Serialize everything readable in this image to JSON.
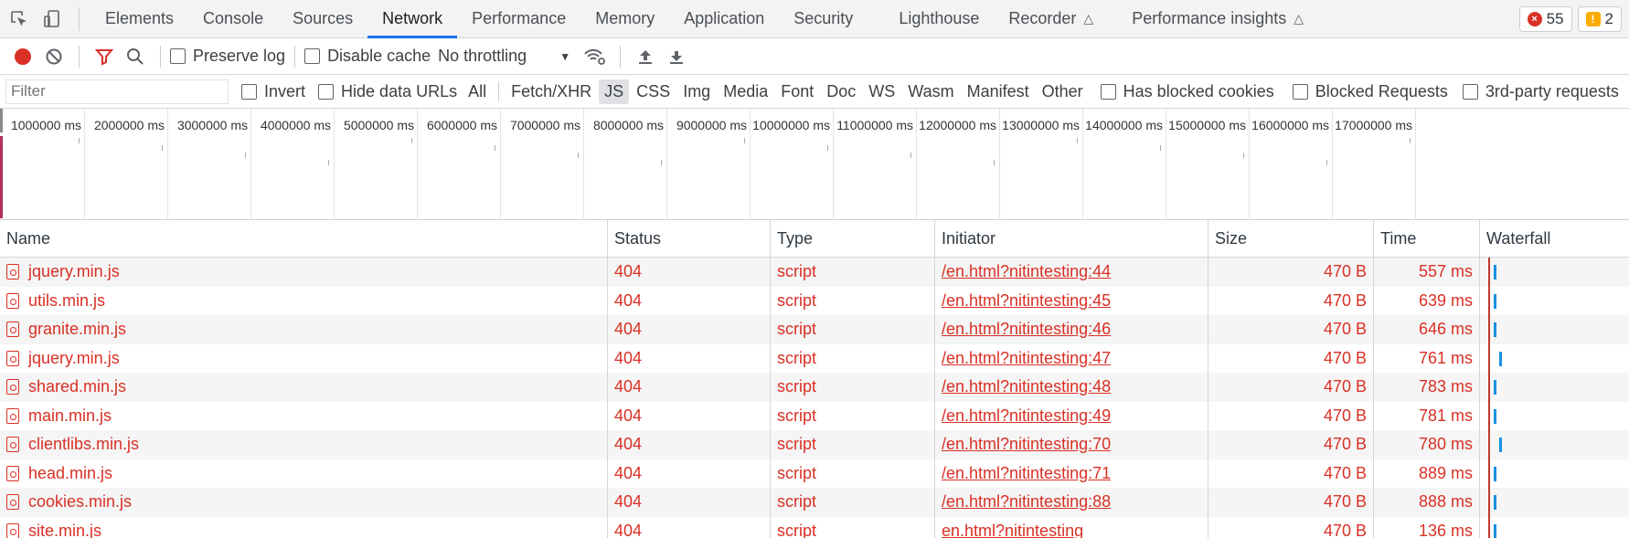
{
  "tabs": {
    "items": [
      "Elements",
      "Console",
      "Sources",
      "Network",
      "Performance",
      "Memory",
      "Application",
      "Security",
      "Lighthouse",
      "Recorder",
      "Performance insights"
    ],
    "errors": "55",
    "warnings": "2"
  },
  "toolbar": {
    "preserve_log": "Preserve log",
    "disable_cache": "Disable cache",
    "throttling": "No throttling"
  },
  "filter": {
    "placeholder": "Filter",
    "invert": "Invert",
    "hide_data_urls": "Hide data URLs",
    "types": [
      "All",
      "Fetch/XHR",
      "JS",
      "CSS",
      "Img",
      "Media",
      "Font",
      "Doc",
      "WS",
      "Wasm",
      "Manifest",
      "Other"
    ],
    "selected_type": "JS",
    "has_blocked_cookies": "Has blocked cookies",
    "blocked_requests": "Blocked Requests",
    "third_party": "3rd-party requests"
  },
  "overview": {
    "ticks": [
      "1000000 ms",
      "2000000 ms",
      "3000000 ms",
      "4000000 ms",
      "5000000 ms",
      "6000000 ms",
      "7000000 ms",
      "8000000 ms",
      "9000000 ms",
      "10000000 ms",
      "11000000 ms",
      "12000000 ms",
      "13000000 ms",
      "14000000 ms",
      "15000000 ms",
      "16000000 ms",
      "17000000 ms"
    ]
  },
  "table": {
    "headers": {
      "name": "Name",
      "status": "Status",
      "type": "Type",
      "initiator": "Initiator",
      "size": "Size",
      "time": "Time",
      "waterfall": "Waterfall"
    },
    "rows": [
      {
        "name": "jquery.min.js",
        "status": "404",
        "type": "script",
        "initiator": "/en.html?nitintesting:44",
        "size": "470 B",
        "time": "557 ms"
      },
      {
        "name": "utils.min.js",
        "status": "404",
        "type": "script",
        "initiator": "/en.html?nitintesting:45",
        "size": "470 B",
        "time": "639 ms"
      },
      {
        "name": "granite.min.js",
        "status": "404",
        "type": "script",
        "initiator": "/en.html?nitintesting:46",
        "size": "470 B",
        "time": "646 ms"
      },
      {
        "name": "jquery.min.js",
        "status": "404",
        "type": "script",
        "initiator": "/en.html?nitintesting:47",
        "size": "470 B",
        "time": "761 ms"
      },
      {
        "name": "shared.min.js",
        "status": "404",
        "type": "script",
        "initiator": "/en.html?nitintesting:48",
        "size": "470 B",
        "time": "783 ms"
      },
      {
        "name": "main.min.js",
        "status": "404",
        "type": "script",
        "initiator": "/en.html?nitintesting:49",
        "size": "470 B",
        "time": "781 ms"
      },
      {
        "name": "clientlibs.min.js",
        "status": "404",
        "type": "script",
        "initiator": "/en.html?nitintesting:70",
        "size": "470 B",
        "time": "780 ms"
      },
      {
        "name": "head.min.js",
        "status": "404",
        "type": "script",
        "initiator": "/en.html?nitintesting:71",
        "size": "470 B",
        "time": "889 ms"
      },
      {
        "name": "cookies.min.js",
        "status": "404",
        "type": "script",
        "initiator": "/en.html?nitintesting:88",
        "size": "470 B",
        "time": "888 ms"
      },
      {
        "name": "site.min.js",
        "status": "404",
        "type": "script",
        "initiator": "en.html?nitintesting",
        "size": "470 B",
        "time": "136 ms"
      }
    ]
  },
  "colors": {
    "accent": "#1a73e8",
    "error": "#d93025",
    "record": "#d93025",
    "filter_icon": "#d93025",
    "waterfall_bar": "#1a8fe3"
  }
}
